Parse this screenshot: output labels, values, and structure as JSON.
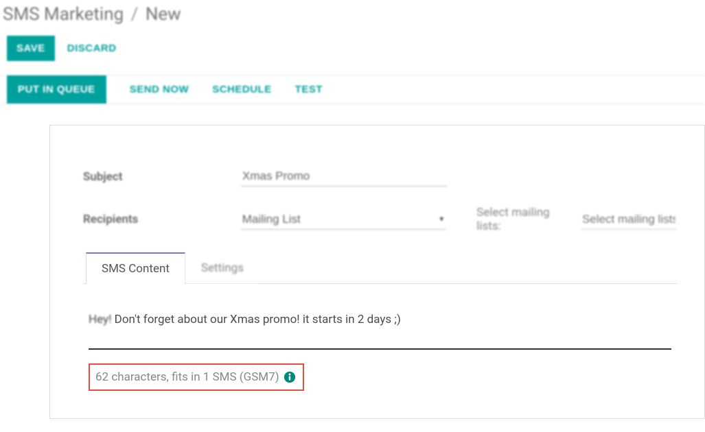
{
  "breadcrumb": {
    "root": "SMS Marketing",
    "current": "New"
  },
  "topButtons": {
    "save": "SAVE",
    "discard": "DISCARD"
  },
  "actionBar": {
    "queue": "PUT IN QUEUE",
    "sendNow": "SEND NOW",
    "schedule": "SCHEDULE",
    "test": "TEST"
  },
  "form": {
    "subjectLabel": "Subject",
    "subjectValue": "Xmas Promo",
    "recipientsLabel": "Recipients",
    "recipientsValue": "Mailing List",
    "mailingSelectLabel": "Select mailing lists:",
    "mailingSelectPlaceholder": "Select mailing lists"
  },
  "tabs": {
    "content": "SMS Content",
    "settings": "Settings"
  },
  "sms": {
    "firstWord": "Hey!",
    "rest": " Don't forget about our Xmas promo! it starts in 2 days ;)",
    "charCount": "62 characters, fits in 1 SMS (GSM7)"
  }
}
